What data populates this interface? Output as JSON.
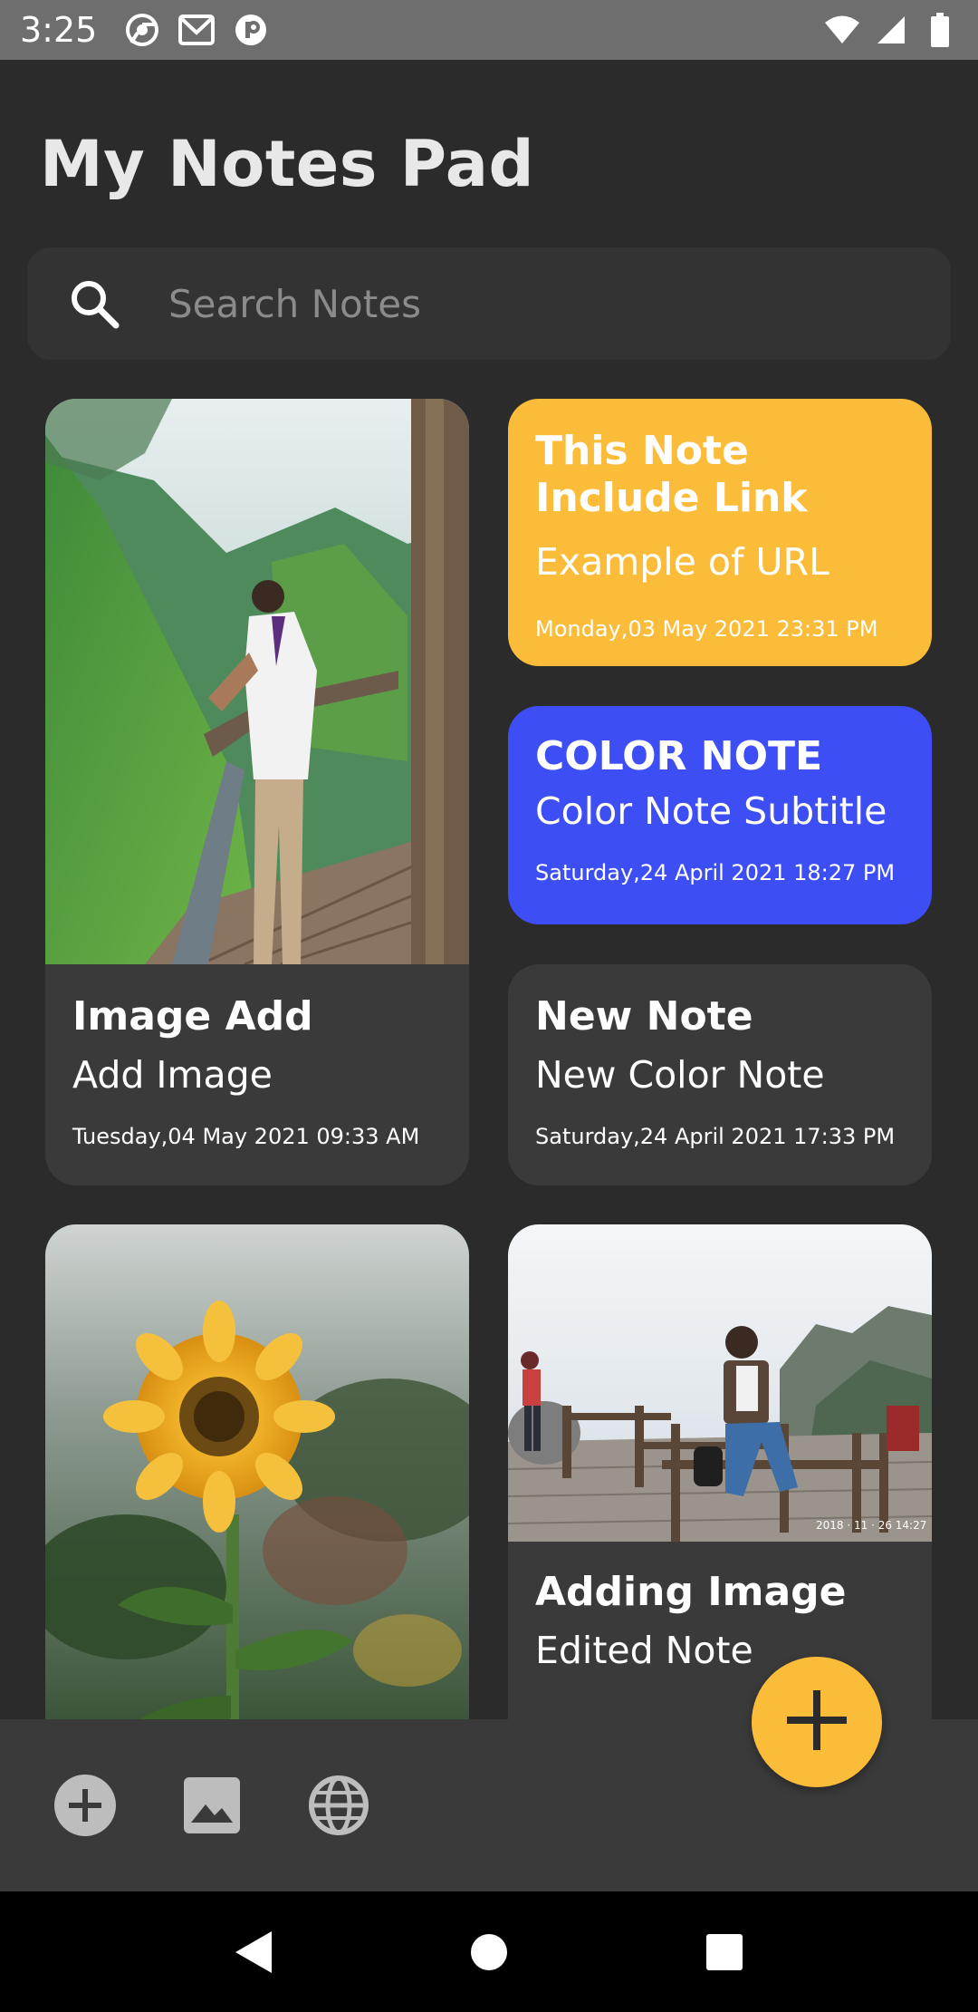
{
  "status_bar": {
    "time": "3:25",
    "left_icons": [
      "chrome-icon",
      "gmail-icon",
      "app-icon"
    ],
    "right_icons": [
      "wifi-icon",
      "signal-icon",
      "battery-icon"
    ]
  },
  "header": {
    "title": "My Notes Pad"
  },
  "search": {
    "placeholder": "Search Notes",
    "value": ""
  },
  "notes": [
    {
      "id": "image-add",
      "title": "Image Add",
      "subtitle": "Add Image",
      "date": "Tuesday,04 May 2021 09:33 AM",
      "has_image": true,
      "image_desc": "man-on-boardwalk-photo"
    },
    {
      "id": "include-link",
      "title": "This Note Include Link",
      "subtitle": "Example of URL",
      "date": "Monday,03 May 2021 23:31 PM",
      "color": "#fbbc3a"
    },
    {
      "id": "color-note",
      "title": "COLOR NOTE",
      "subtitle": "Color Note Subtitle",
      "date": "Saturday,24 April 2021 18:27 PM",
      "color": "#3d4ef5"
    },
    {
      "id": "new-note",
      "title": "New Note",
      "subtitle": "New Color Note",
      "date": "Saturday,24 April 2021 17:33 PM",
      "color": "#3a3a3a"
    },
    {
      "id": "sunflower",
      "has_image": true,
      "image_desc": "sunflower-photo"
    },
    {
      "id": "adding-image",
      "title": "Adding Image",
      "subtitle": "Edited Note",
      "has_image": true,
      "image_desc": "man-at-viewpoint-photo",
      "photo_stamp": "2018 · 11 · 26 14:27"
    }
  ],
  "toolbar": {
    "icons": [
      "add-circle-icon",
      "image-icon",
      "globe-icon"
    ]
  },
  "fab": {
    "icon": "plus-icon",
    "color": "#fbbc3a"
  },
  "nav_bar": {
    "icons": [
      "back-icon",
      "home-icon",
      "recents-icon"
    ]
  },
  "colors": {
    "background": "#2b2b2b",
    "card": "#3a3a3a",
    "accent_yellow": "#fbbc3a",
    "accent_blue": "#3d4ef5"
  }
}
